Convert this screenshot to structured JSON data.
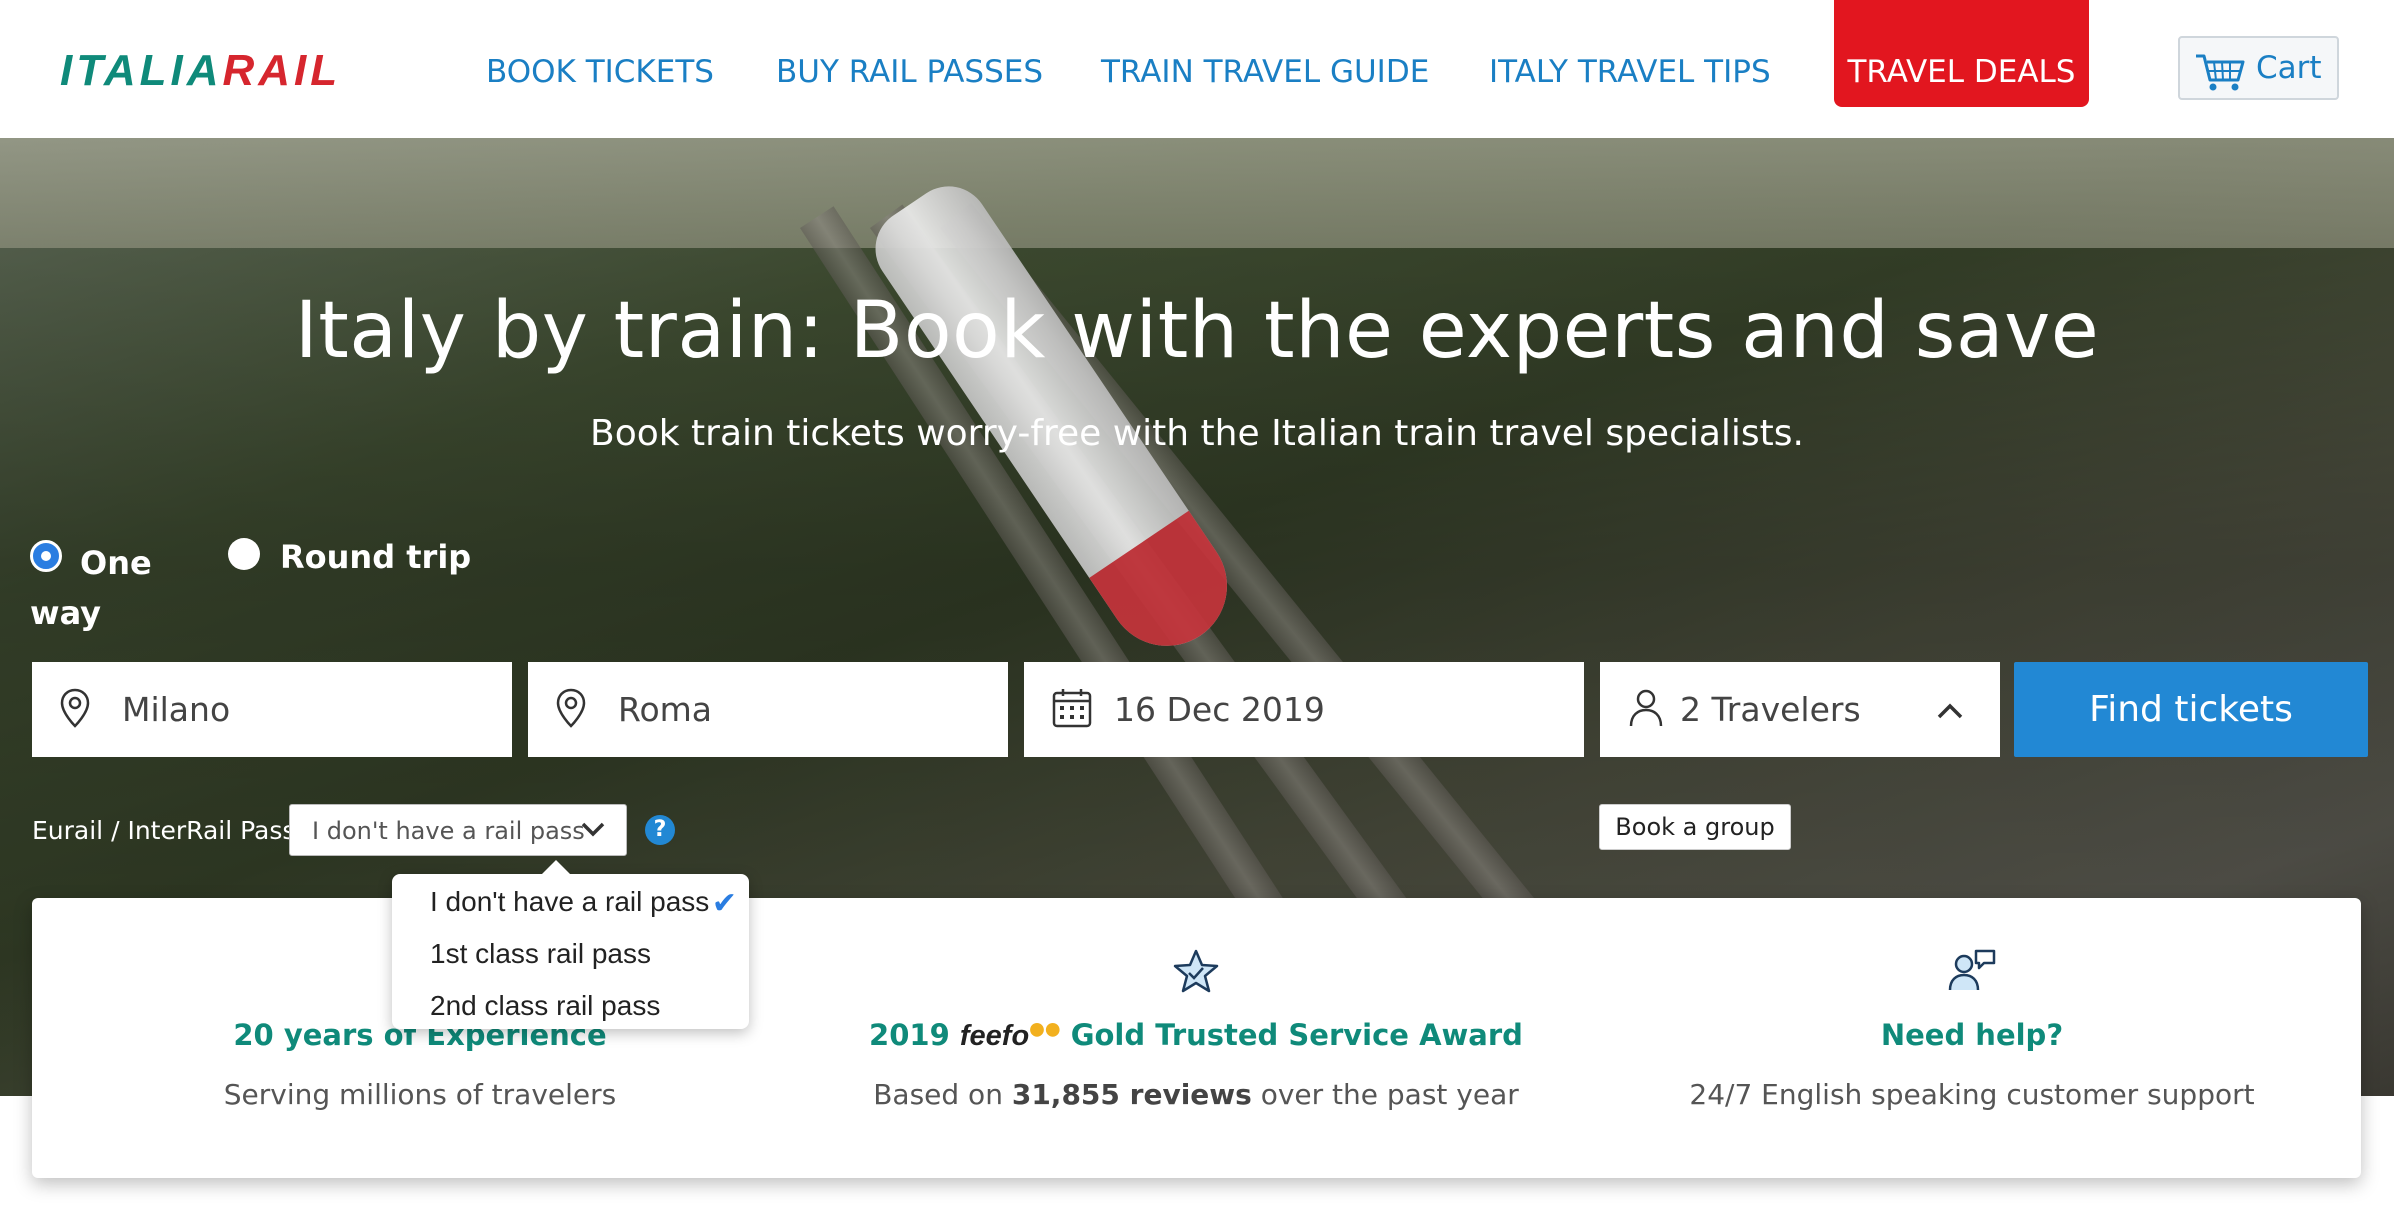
{
  "header": {
    "logo_italia": "ITALIA",
    "logo_rail": "RAIL",
    "nav": [
      {
        "label": "BOOK TICKETS"
      },
      {
        "label": "BUY RAIL PASSES"
      },
      {
        "label": "TRAIN TRAVEL GUIDE"
      },
      {
        "label": "ITALY TRAVEL TIPS"
      }
    ],
    "deals_label": "TRAVEL DEALS",
    "cart_label": "Cart"
  },
  "hero": {
    "title": "Italy by train: Book with the experts and save",
    "subtitle": "Book train tickets worry-free with the Italian train travel specialists."
  },
  "search": {
    "trip_types": [
      {
        "label": "One way",
        "selected": true
      },
      {
        "label": "Round trip",
        "selected": false
      }
    ],
    "from": "Milano",
    "to": "Roma",
    "date": "16 Dec 2019",
    "travelers": "2 Travelers",
    "find_label": "Find tickets",
    "pass_label": "Eurail / InterRail Pass",
    "pass_selected": "I don't have a rail pass",
    "help_symbol": "?",
    "group_label": "Book a group"
  },
  "dropdown": {
    "options": [
      {
        "label": "I don't have a rail pass",
        "selected": true
      },
      {
        "label": "1st class rail pass",
        "selected": false
      },
      {
        "label": "2nd class rail pass",
        "selected": false
      }
    ]
  },
  "info": [
    {
      "icon": "award-icon",
      "title": "20 years of Experience",
      "desc": "Serving millions of travelers"
    },
    {
      "icon": "star-icon",
      "title_year": "2019",
      "title_brand": "feefo",
      "title_rest": "Gold Trusted Service Award",
      "desc_pre": "Based on ",
      "desc_bold": "31,855 reviews",
      "desc_post": " over the past year"
    },
    {
      "icon": "support-person-icon",
      "title": "Need help?",
      "desc": "24/7 English speaking customer support"
    }
  ],
  "colors": {
    "brand_teal": "#0f8a7a",
    "brand_red": "#d6262e",
    "link_blue": "#1a7fc4",
    "deals_red": "#e2161f",
    "button_blue": "#2288d4"
  }
}
